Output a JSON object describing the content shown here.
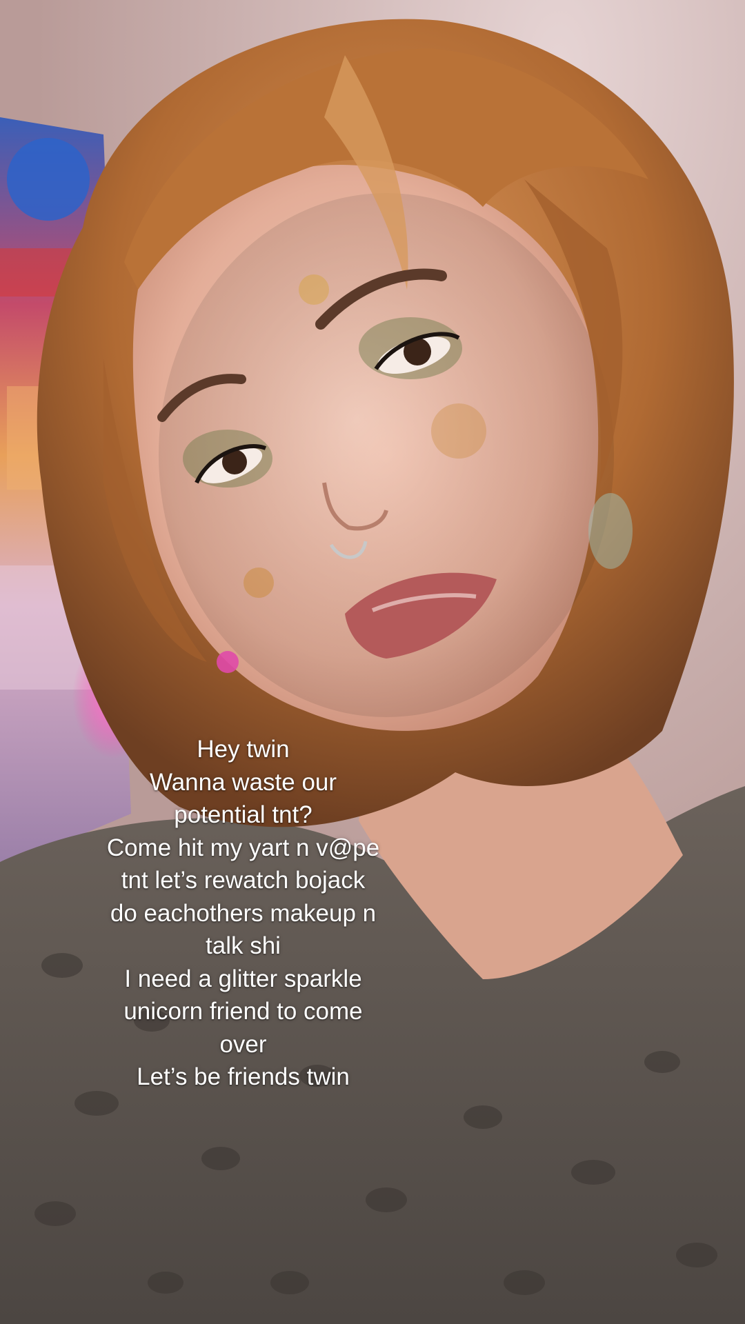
{
  "caption": {
    "lines": [
      "Hey twin",
      "Wanna waste our",
      "potential tnt?",
      "Come hit my yart n v@pe",
      "tnt let’s rewatch bojack",
      "do eachothers makeup n",
      "talk shi",
      "I need a glitter sparkle",
      "unicorn friend to come",
      "over",
      "Let’s be friends twin"
    ]
  },
  "colors": {
    "caption_text": "#ffffff",
    "wall": "#d9c3c3",
    "hair": "#c07a3c",
    "skin": "#e8b9a6",
    "lips": "#b45a5a",
    "shirt": "#5e5651",
    "neon_accent": "#ff3fb0"
  }
}
